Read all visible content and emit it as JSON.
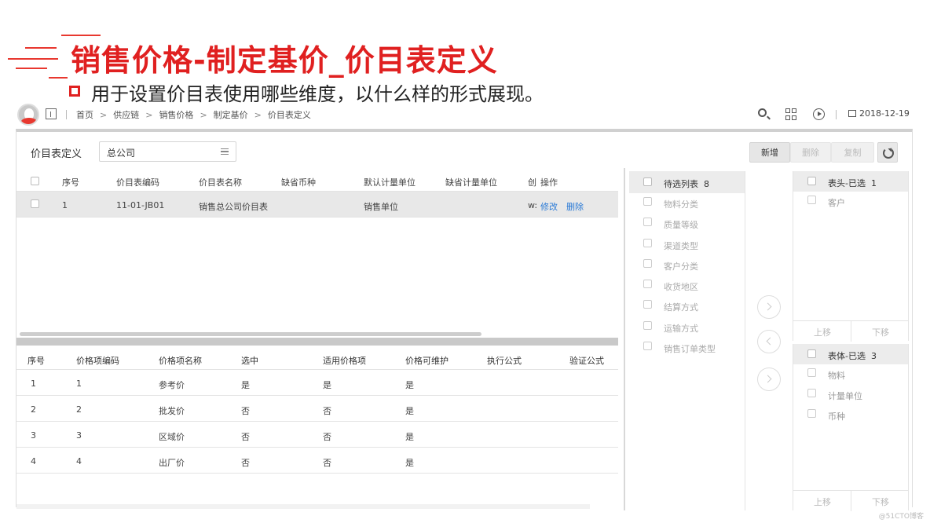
{
  "slide": {
    "title": "销售价格-制定基价_价目表定义",
    "subtitle": "用于设置价目表使用哪些维度，以什么样的形式展现。"
  },
  "topbar": {
    "breadcrumb": [
      "首页",
      "供应链",
      "销售价格",
      "制定基价",
      "价目表定义"
    ],
    "date": "2018-12-19",
    "icons": [
      "avatar",
      "org-icon",
      "search-icon",
      "apps-grid-icon",
      "play-icon",
      "calendar-icon"
    ]
  },
  "toolbar": {
    "title": "价目表定义",
    "org_value": "总公司",
    "buttons": {
      "new": "新增",
      "delete": "删除",
      "copy": "复制"
    }
  },
  "price_list_table": {
    "headers": [
      "序号",
      "价目表编码",
      "价目表名称",
      "缺省币种",
      "默认计量单位",
      "缺省计量单位",
      "创",
      "操作"
    ],
    "rows": [
      {
        "index": "1",
        "code": "11-01-JB01",
        "name": "销售总公司价目表",
        "currency": "",
        "unit": "销售单位",
        "default_unit": "",
        "creator": "w:",
        "edit": "修改",
        "delete": "删除"
      }
    ]
  },
  "price_item_table": {
    "headers": [
      "序号",
      "价格项编码",
      "价格项名称",
      "选中",
      "适用价格项",
      "价格可维护",
      "执行公式",
      "验证公式"
    ],
    "rows": [
      {
        "index": "1",
        "code": "1",
        "name": "参考价",
        "selected": "是",
        "applicable": "是",
        "maintainable": "是"
      },
      {
        "index": "2",
        "code": "2",
        "name": "批发价",
        "selected": "否",
        "applicable": "否",
        "maintainable": "是"
      },
      {
        "index": "3",
        "code": "3",
        "name": "区域价",
        "selected": "否",
        "applicable": "否",
        "maintainable": "是"
      },
      {
        "index": "4",
        "code": "4",
        "name": "出厂价",
        "selected": "否",
        "applicable": "否",
        "maintainable": "是"
      }
    ]
  },
  "candidate_list": {
    "label": "待选列表",
    "count": "8",
    "items": [
      "物料分类",
      "质量等级",
      "渠道类型",
      "客户分类",
      "收货地区",
      "结算方式",
      "运输方式",
      "销售订单类型"
    ]
  },
  "header_selected": {
    "label": "表头-已选",
    "count": "1",
    "items": [
      "客户"
    ],
    "move_up": "上移",
    "move_down": "下移"
  },
  "body_selected": {
    "label": "表体-已选",
    "count": "3",
    "items": [
      "物料",
      "计量单位",
      "币种"
    ],
    "move_up": "上移",
    "move_down": "下移"
  },
  "watermark": "@51CTO博客",
  "colors": {
    "accent": "#e02020",
    "link": "#2a7ad6"
  }
}
